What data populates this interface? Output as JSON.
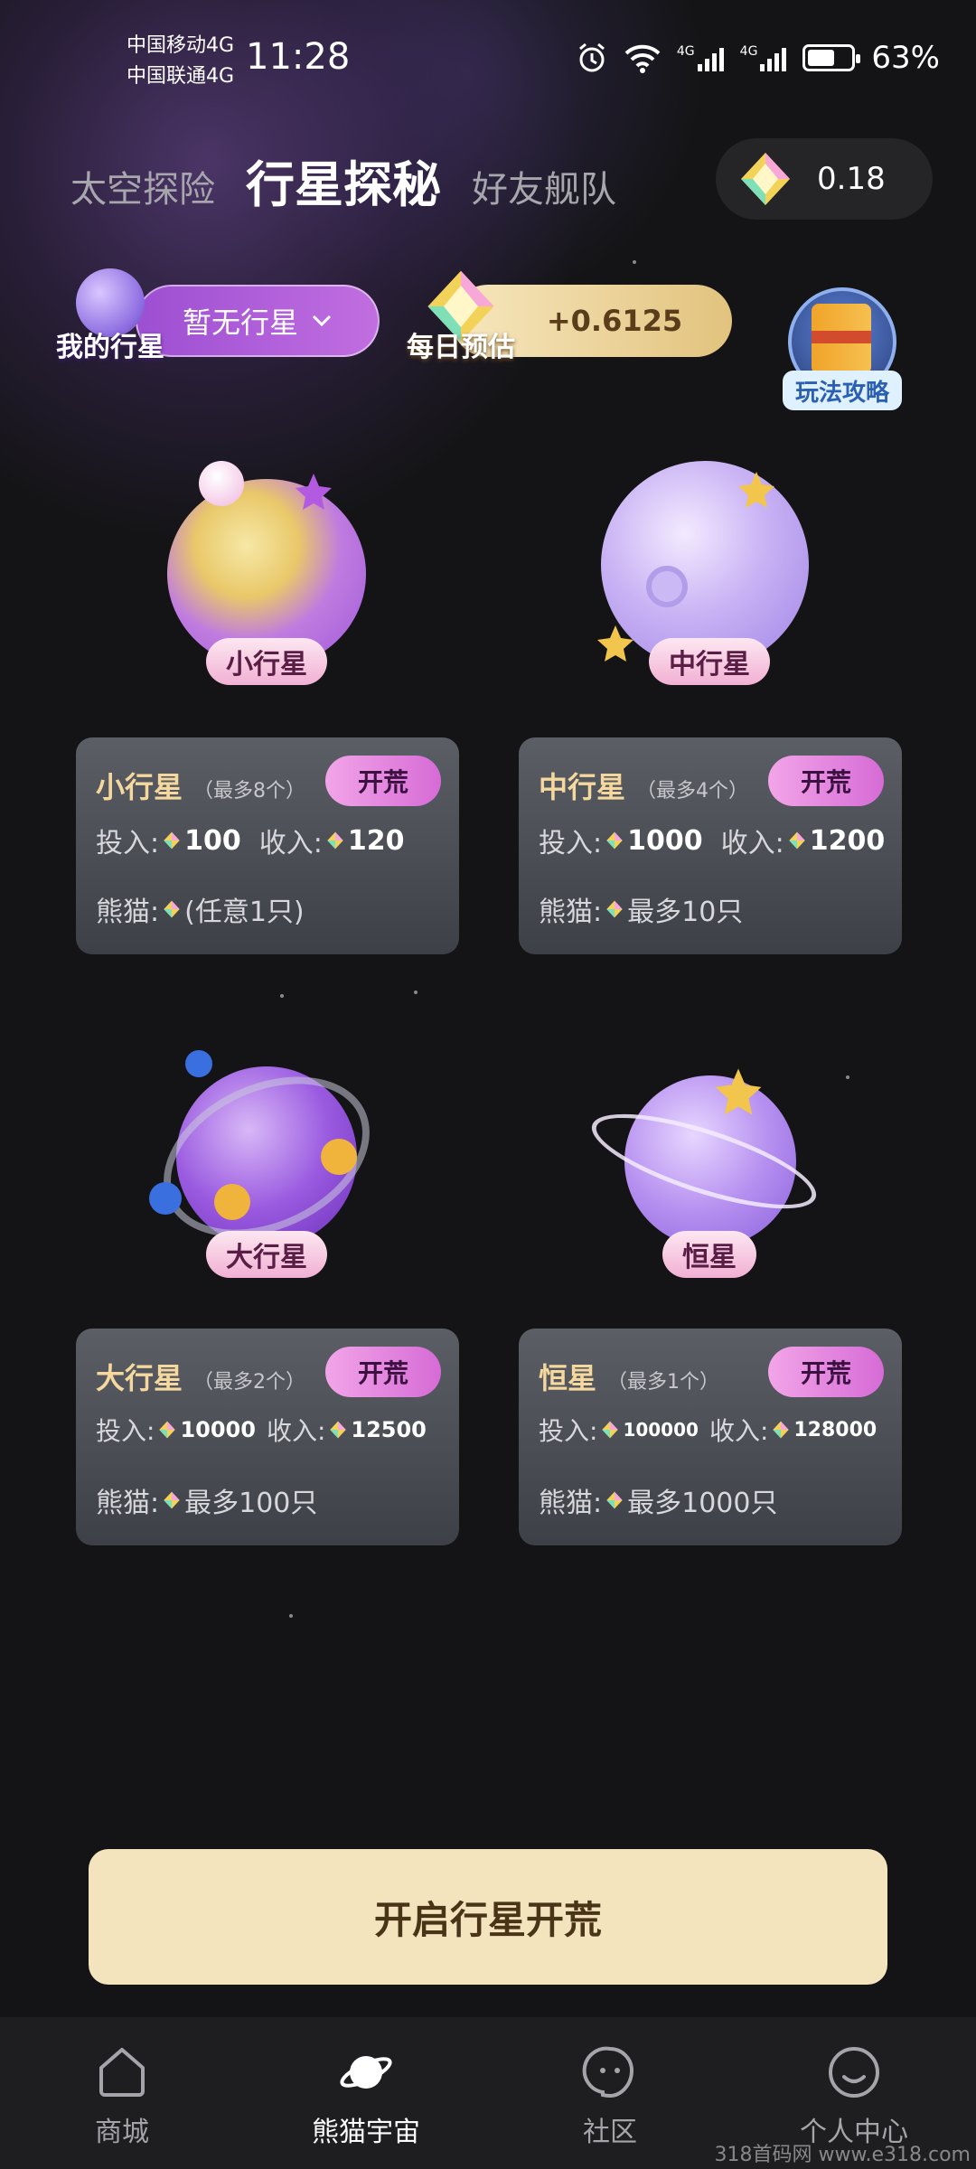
{
  "status_bar": {
    "carrier_1": "中国移动4G",
    "carrier_2": "中国联通4G",
    "time": "11:28",
    "network_1": "4G",
    "network_2": "4G",
    "battery": "63%",
    "battery_level": 0.63
  },
  "tabs": [
    {
      "label": "太空探险",
      "active": false
    },
    {
      "label": "行星探秘",
      "active": true
    },
    {
      "label": "好友舰队",
      "active": false
    }
  ],
  "gem_balance": "0.18",
  "my_planet": {
    "label": "我的行星",
    "value": "暂无行星",
    "icon": "chevron-down-icon"
  },
  "daily_estimate": {
    "label": "每日预估",
    "value": "+0.6125"
  },
  "guide": {
    "label": "玩法攻略"
  },
  "planets": [
    {
      "name": "小行星",
      "limit": "（最多8个）",
      "button": "开荒",
      "invest_label": "投入:",
      "invest": "100",
      "income_label": "收入:",
      "income": "120",
      "panda_label": "熊猫:",
      "panda": "(任意1只)"
    },
    {
      "name": "中行星",
      "limit": "（最多4个）",
      "button": "开荒",
      "invest_label": "投入:",
      "invest": "1000",
      "income_label": "收入:",
      "income": "1200",
      "panda_label": "熊猫:",
      "panda": "最多10只"
    },
    {
      "name": "大行星",
      "limit": "（最多2个）",
      "button": "开荒",
      "invest_label": "投入:",
      "invest": "10000",
      "income_label": "收入:",
      "income": "12500",
      "panda_label": "熊猫:",
      "panda": "最多100只"
    },
    {
      "name": "恒星",
      "limit": "（最多1个）",
      "button": "开荒",
      "invest_label": "投入:",
      "invest": "100000",
      "income_label": "收入:",
      "income": "128000",
      "panda_label": "熊猫:",
      "panda": "最多1000只"
    }
  ],
  "start_button": "开启行星开荒",
  "nav": [
    {
      "label": "商城",
      "icon": "shop-icon",
      "active": false
    },
    {
      "label": "熊猫宇宙",
      "icon": "planet-icon",
      "active": true
    },
    {
      "label": "社区",
      "icon": "community-icon",
      "active": false
    },
    {
      "label": "个人中心",
      "icon": "profile-icon",
      "active": false
    }
  ],
  "watermark": "318首码网 www.e318.com"
}
